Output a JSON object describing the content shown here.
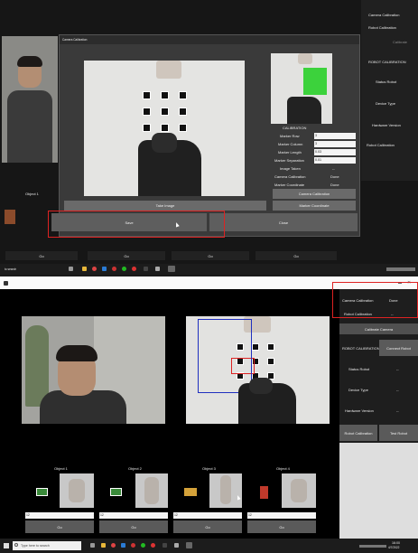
{
  "top": {
    "side_menu": [
      "Camera Calibration",
      "Robot Calibration",
      "Calibrate",
      "ROBOT CALIBRATION",
      "Status Robot",
      "Device Type",
      "Hardware Version",
      "Robot Calibration"
    ],
    "object_label": "Object 1",
    "dialog": {
      "title": "Camera Calibration",
      "calibration_header": "CALIBRATION",
      "fields": [
        {
          "label": "Marker Row",
          "value": "3"
        },
        {
          "label": "Marker Column",
          "value": "3"
        },
        {
          "label": "Marker Length",
          "value": "0.03"
        },
        {
          "label": "Marker Separation",
          "value": "0.01"
        }
      ],
      "status": [
        {
          "label": "Image Taken",
          "value": "--"
        },
        {
          "label": "Camera Calibration",
          "value": "Done"
        },
        {
          "label": "Marker Coordinate",
          "value": "Done"
        }
      ],
      "camera_calibration_button": "Camera Calibration",
      "marker_coordinate_button": "Marker Coordinate",
      "take_image_button": "Take Image",
      "save_button": "Save",
      "close_button": "Close"
    },
    "bottom_buttons": [
      "Go",
      "Go",
      "Go",
      "Go"
    ],
    "search_text": "to search"
  },
  "bottom": {
    "right_panel": {
      "camera_calibration": {
        "label": "Camera Calibration",
        "value": "Done"
      },
      "robot_calibration": {
        "label": "Robot Calibration",
        "value": "--"
      },
      "calibrate_camera_button": "Calibrate Camera",
      "robot_calibration_label": "ROBOT CALIBRATION",
      "connect_robot_button": "Connect Robot",
      "status_robot": {
        "label": "Status Robot",
        "value": "--"
      },
      "device_type": {
        "label": "Device Type",
        "value": "--"
      },
      "hardware_version": {
        "label": "Hardware Version",
        "value": "--"
      },
      "robot_calibration_button": "Robot Calibration",
      "test_robot_button": "Test Robot"
    },
    "objects": [
      {
        "label": "Object 1",
        "input": "12",
        "go": "Go"
      },
      {
        "label": "Object 2",
        "input": "12",
        "go": "Go"
      },
      {
        "label": "Object 3",
        "input": "12",
        "go": "Go"
      },
      {
        "label": "Object 4",
        "input": "12",
        "go": "Go"
      }
    ],
    "search_placeholder": "Type here to search",
    "clock": {
      "time": "16:00",
      "date": "4/7/2022"
    }
  },
  "colors": {
    "highlight": "#d22222",
    "roi": "#1f2fbf",
    "marker_green": "#3cd23c"
  }
}
